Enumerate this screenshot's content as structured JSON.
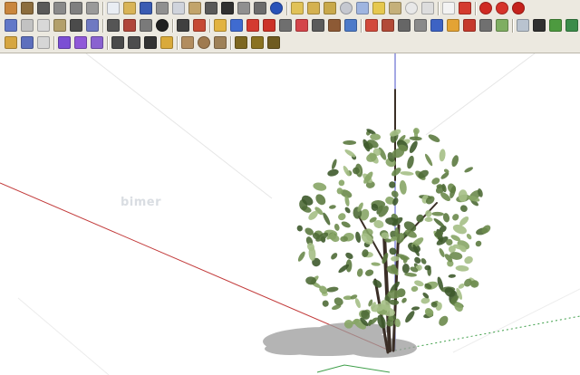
{
  "toolbar": {
    "rows": [
      [
        {
          "icon": "warehouse-icon",
          "color": "#c9863d"
        },
        {
          "icon": "component-icon",
          "color": "#8c6d3d"
        },
        {
          "icon": "house-icon",
          "color": "#5a5a5a"
        },
        {
          "icon": "house-outline-icon",
          "color": "#8a8a8a"
        },
        {
          "icon": "front-view-icon",
          "color": "#7f7f7f"
        },
        {
          "icon": "back-view-icon",
          "color": "#9a9a9a"
        },
        {
          "sep": true
        },
        {
          "icon": "new-file-icon",
          "color": "#e9edf3"
        },
        {
          "icon": "open-folder-icon",
          "color": "#d9b457"
        },
        {
          "icon": "save-icon",
          "color": "#3a5bb2"
        },
        {
          "icon": "cut-icon",
          "color": "#909090"
        },
        {
          "icon": "copy-icon",
          "color": "#d0d4dc"
        },
        {
          "icon": "paste-icon",
          "color": "#c2a46b"
        },
        {
          "icon": "erase-icon",
          "color": "#595959"
        },
        {
          "icon": "undo-icon",
          "color": "#303030"
        },
        {
          "icon": "redo-icon",
          "color": "#909090"
        },
        {
          "icon": "print-icon",
          "color": "#6c6c6c"
        },
        {
          "icon": "info-icon",
          "color": "#2852b8",
          "round": true
        },
        {
          "sep": true
        },
        {
          "icon": "tag-icon",
          "color": "#e1c257"
        },
        {
          "icon": "tag2-icon",
          "color": "#d4b150"
        },
        {
          "icon": "tag3-icon",
          "color": "#c9a94b"
        },
        {
          "icon": "sphere-icon",
          "color": "#c5c8d0",
          "round": true
        },
        {
          "icon": "cube-blue-icon",
          "color": "#9fb5e0"
        },
        {
          "icon": "cube-yellow-icon",
          "color": "#e6c84e"
        },
        {
          "icon": "scene-icon",
          "color": "#c5b07a"
        },
        {
          "icon": "circle-outline-icon",
          "color": "#e8e8e8",
          "round": true
        },
        {
          "icon": "cube-outline-icon",
          "color": "#dddddd"
        },
        {
          "sep": true
        },
        {
          "icon": "po-text-icon",
          "color": "#f3f3f3"
        },
        {
          "icon": "close-x-icon",
          "color": "#d43b2e"
        },
        {
          "sep": true
        },
        {
          "icon": "red-ball-icon",
          "color": "#cf2a23",
          "round": true
        },
        {
          "icon": "red-ball2-icon",
          "color": "#d6332a",
          "round": true
        },
        {
          "icon": "red-ball3-icon",
          "color": "#c5221c",
          "round": true
        }
      ],
      [
        {
          "icon": "iso-view-icon",
          "color": "#6278c8"
        },
        {
          "icon": "top-view-icon",
          "color": "#c2c2c2"
        },
        {
          "icon": "box-view-icon",
          "color": "#d8d8d8"
        },
        {
          "icon": "right-view-icon",
          "color": "#b3a06a"
        },
        {
          "icon": "left-view-icon",
          "color": "#4b4b4b"
        },
        {
          "icon": "perspective-icon",
          "color": "#6f79c2"
        },
        {
          "sep": true
        },
        {
          "icon": "photo-icon",
          "color": "#555555"
        },
        {
          "icon": "section-icon",
          "color": "#b0463a"
        },
        {
          "icon": "shaded-icon",
          "color": "#7a7a7a"
        },
        {
          "icon": "black-ball-icon",
          "color": "#202020",
          "round": true
        },
        {
          "sep": true
        },
        {
          "icon": "curve-icon",
          "color": "#404040"
        },
        {
          "icon": "paint-icon",
          "color": "#c64a33"
        },
        {
          "sep": true
        },
        {
          "icon": "pencil-icon",
          "color": "#e2b340"
        },
        {
          "icon": "eraser-icon",
          "color": "#3f6bd0"
        },
        {
          "icon": "mesh-icon",
          "color": "#d43a2f"
        },
        {
          "icon": "cross-icon",
          "color": "#cc3328"
        },
        {
          "icon": "grid-icon",
          "color": "#6f6f6f"
        },
        {
          "icon": "wand-icon",
          "color": "#d4454a"
        },
        {
          "icon": "drape-icon",
          "color": "#5b5b5b"
        },
        {
          "icon": "chair-icon",
          "color": "#8d5a35"
        },
        {
          "icon": "filter-icon",
          "color": "#4e7bc9"
        },
        {
          "sep": true
        },
        {
          "icon": "arrow-split-icon",
          "color": "#d24a3b"
        },
        {
          "icon": "stairs-icon",
          "color": "#b24a37"
        },
        {
          "icon": "pen-icon",
          "color": "#666666"
        },
        {
          "icon": "wall-icon",
          "color": "#8a8a8a"
        },
        {
          "icon": "blue-grid-icon",
          "color": "#3d63c4"
        },
        {
          "icon": "orange-cube-icon",
          "color": "#e3a334"
        },
        {
          "icon": "red-knot-icon",
          "color": "#c63a2d"
        },
        {
          "icon": "script-icon",
          "color": "#707070"
        },
        {
          "icon": "green-sheet-icon",
          "color": "#7fae62"
        },
        {
          "sep": true
        },
        {
          "icon": "map-icon",
          "color": "#b9c3cf"
        },
        {
          "icon": "dot-icon",
          "color": "#303030"
        },
        {
          "icon": "green-box-icon",
          "color": "#4d9a3f"
        },
        {
          "icon": "green-grid-icon",
          "color": "#3b8c4a"
        }
      ],
      [
        {
          "icon": "pencil-edit-icon",
          "color": "#d6a640"
        },
        {
          "icon": "brush-icon",
          "color": "#5d6fbd"
        },
        {
          "icon": "panel-icon",
          "color": "#d6d6d6"
        },
        {
          "sep": true
        },
        {
          "icon": "purple-cube-icon",
          "color": "#7b4fd4"
        },
        {
          "icon": "violet-cube-icon",
          "color": "#9058d8"
        },
        {
          "icon": "lilac-cube-icon",
          "color": "#8a62d0"
        },
        {
          "sep": true
        },
        {
          "icon": "arc-icon",
          "color": "#4a4a4a"
        },
        {
          "icon": "line-draw-icon",
          "color": "#4d4d4d"
        },
        {
          "icon": "scale-icon",
          "color": "#333333"
        },
        {
          "icon": "yellow-pencil-icon",
          "color": "#d9aa3a"
        },
        {
          "sep": true
        },
        {
          "icon": "cone-icon",
          "color": "#b28d5f"
        },
        {
          "icon": "sphere-brown-icon",
          "color": "#9f7a4f",
          "round": true
        },
        {
          "icon": "cone2-icon",
          "color": "#9e8158"
        },
        {
          "sep": true
        },
        {
          "icon": "gear-icon",
          "color": "#7d6720"
        },
        {
          "icon": "lightbulb-icon",
          "color": "#8a7221"
        },
        {
          "icon": "tools-icon",
          "color": "#6f5b20"
        }
      ]
    ]
  },
  "viewport": {
    "watermark": "bimer",
    "axis_colors": {
      "red": "#c23a3a",
      "blue": "#4a52c8",
      "green": "#3f9f4a"
    }
  }
}
